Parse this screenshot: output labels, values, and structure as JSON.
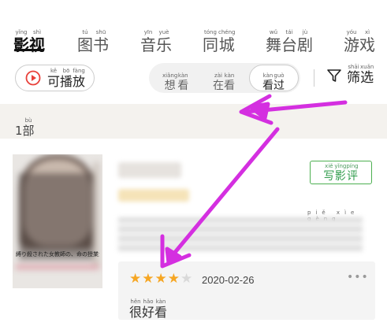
{
  "tabs": [
    {
      "chars": "影视",
      "pinyin": [
        "yǐng",
        "shì"
      ],
      "active": true
    },
    {
      "chars": "图书",
      "pinyin": [
        "tú",
        "shū"
      ],
      "active": false
    },
    {
      "chars": "音乐",
      "pinyin": [
        "yīn",
        "yuè"
      ],
      "active": false
    },
    {
      "chars": "同城",
      "pinyin": [
        "tóng",
        "chéng"
      ],
      "active": false
    },
    {
      "chars": "舞台剧",
      "pinyin": [
        "wǔ",
        "tái",
        "jù"
      ],
      "active": false
    },
    {
      "chars": "游戏",
      "pinyin": [
        "yóu",
        "xì"
      ],
      "active": false
    }
  ],
  "filters": {
    "playable": {
      "chars": "可播放",
      "pinyin": [
        "kě",
        "bō",
        "fàng"
      ]
    },
    "segments": [
      {
        "chars": "想看",
        "pinyin": [
          "xiǎng",
          "kàn"
        ],
        "active": false
      },
      {
        "chars": "在看",
        "pinyin": [
          "zài",
          "kàn"
        ],
        "active": false
      },
      {
        "chars": "看过",
        "pinyin": [
          "kàn",
          "guò"
        ],
        "active": true
      }
    ],
    "filter_button": {
      "chars": "筛选",
      "pinyin": [
        "shāi",
        "xuǎn"
      ]
    }
  },
  "count": {
    "text": "1部",
    "pinyin_unit": "bù"
  },
  "item": {
    "review_button": {
      "chars": "写影评",
      "pinyin": [
        "xiě",
        "yǐng",
        "píng"
      ]
    },
    "info_pinyin": "piě  xìe  gèng",
    "poster_caption": "縛り殺された女教師の、命の授業がはじまる",
    "review": {
      "rating": 4,
      "max_rating": 5,
      "date": "2020-02-26",
      "text_chars": "很好看",
      "text_pinyin": [
        "hěn",
        "hǎo",
        "kàn"
      ],
      "more_label": "•••"
    }
  },
  "colors": {
    "accent_green": "#4caf50",
    "star": "#f6a623",
    "play_icon": "#e8403a",
    "annotation_arrow": "#d42fe0"
  }
}
